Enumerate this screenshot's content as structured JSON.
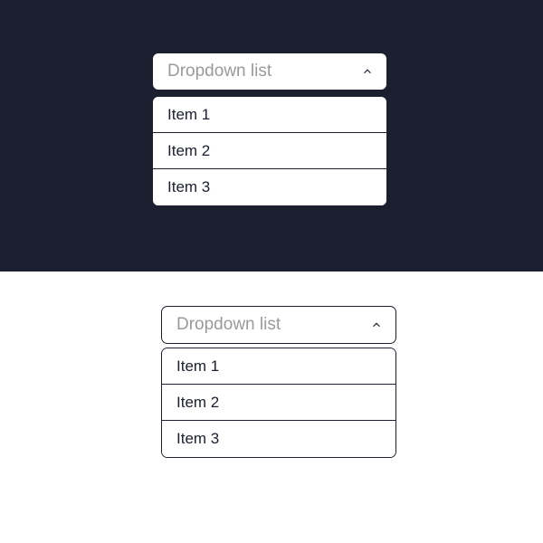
{
  "dark": {
    "label": "Dropdown list",
    "items": [
      "Item 1",
      "Item 2",
      "Item 3"
    ]
  },
  "light": {
    "label": "Dropdown list",
    "items": [
      "Item 1",
      "Item 2",
      "Item 3"
    ]
  },
  "colors": {
    "dark_bg": "#1b1f2f",
    "placeholder": "#9a9a9a",
    "border": "#1b1f2f"
  }
}
